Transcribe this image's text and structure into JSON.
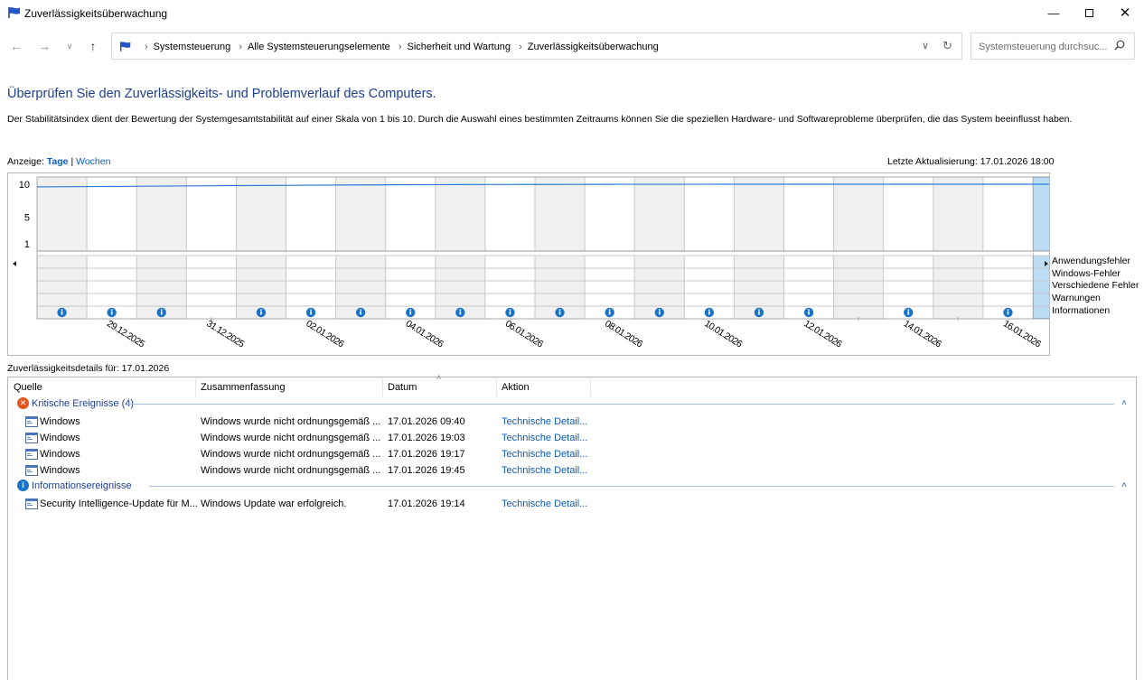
{
  "window": {
    "title": "Zuverlässigkeitsüberwachung"
  },
  "breadcrumbs": [
    "Systemsteuerung",
    "Alle Systemsteuerungselemente",
    "Sicherheit und Wartung",
    "Zuverlässigkeitsüberwachung"
  ],
  "search": {
    "placeholder": "Systemsteuerung durchsuc..."
  },
  "header": {
    "heading": "Überprüfen Sie den Zuverlässigkeits- und Problemverlauf des Computers.",
    "description": "Der Stabilitätsindex dient der Bewertung der Systemgesamtstabilität auf einer Skala von 1 bis 10. Durch die Auswahl eines bestimmten Zeitraums können Sie die speziellen Hardware- und Softwareprobleme überprüfen, die das System beeinflusst haben."
  },
  "view": {
    "label": "Anzeige:",
    "days": "Tage",
    "sep": "|",
    "weeks": "Wochen"
  },
  "last_update": "Letzte Aktualisierung: 17.01.2026 18:00",
  "chart_data": {
    "type": "line",
    "y_ticks": [
      "10",
      "5",
      "1"
    ],
    "ylim": [
      1,
      10
    ],
    "date_labels": [
      "29.12.2025",
      "31.12.2025",
      "02.01.2026",
      "04.01.2026",
      "06.01.2026",
      "08.01.2026",
      "10.01.2026",
      "12.01.2026",
      "14.01.2026",
      "16.01.2026"
    ],
    "days": [
      "28.12.2025",
      "29.12.2025",
      "30.12.2025",
      "31.12.2025",
      "01.01.2026",
      "02.01.2026",
      "03.01.2026",
      "04.01.2026",
      "05.01.2026",
      "06.01.2026",
      "07.01.2026",
      "08.01.2026",
      "09.01.2026",
      "10.01.2026",
      "11.01.2026",
      "12.01.2026",
      "13.01.2026",
      "14.01.2026",
      "15.01.2026",
      "16.01.2026",
      "17.01.2026"
    ],
    "stability_index": [
      9.6,
      9.65,
      9.7,
      9.75,
      9.8,
      9.84,
      9.88,
      9.91,
      9.94,
      9.96,
      9.97,
      9.98,
      9.99,
      9.99,
      10,
      10,
      10,
      10,
      10,
      10,
      9.0
    ],
    "info_events": [
      1,
      1,
      1,
      0,
      1,
      1,
      1,
      1,
      1,
      1,
      1,
      1,
      1,
      1,
      1,
      1,
      0,
      1,
      0,
      1,
      1
    ],
    "misc_error_events": [
      0,
      0,
      0,
      0,
      0,
      0,
      0,
      0,
      0,
      0,
      0,
      0,
      0,
      0,
      0,
      0,
      0,
      0,
      0,
      0,
      1
    ],
    "selected_day": "17.01.2026",
    "legend": [
      "Anwendungsfehler",
      "Windows-Fehler",
      "Verschiedene Fehler",
      "Warnungen",
      "Informationen"
    ]
  },
  "details": {
    "title": "Zuverlässigkeitsdetails für: 17.01.2026",
    "columns": [
      "Quelle",
      "Zusammenfassung",
      "Datum",
      "Aktion"
    ],
    "groups": [
      {
        "label": "Kritische Ereignisse (4)",
        "rows": [
          {
            "source": "Windows",
            "summary": "Windows wurde nicht ordnungsgemäß ...",
            "date": "17.01.2026 09:40",
            "action": "Technische Detail..."
          },
          {
            "source": "Windows",
            "summary": "Windows wurde nicht ordnungsgemäß ...",
            "date": "17.01.2026 19:03",
            "action": "Technische Detail..."
          },
          {
            "source": "Windows",
            "summary": "Windows wurde nicht ordnungsgemäß ...",
            "date": "17.01.2026 19:17",
            "action": "Technische Detail..."
          },
          {
            "source": "Windows",
            "summary": "Windows wurde nicht ordnungsgemäß ...",
            "date": "17.01.2026 19:45",
            "action": "Technische Detail..."
          }
        ]
      },
      {
        "label": "Informationsereignisse",
        "rows": [
          {
            "source": "Security Intelligence-Update für M...",
            "summary": "Windows Update war erfolgreich.",
            "date": "17.01.2026 19:14",
            "action": "Technische Detail..."
          }
        ]
      }
    ]
  },
  "colors": {
    "accent": "#0b5cb5",
    "heading": "#1e3e8e",
    "line": "#2b7bd6",
    "selection": "#bcdcf4",
    "error": "#e2551f",
    "info": "#1b73c9"
  },
  "icons": {
    "back": "arrow-left-icon",
    "forward": "arrow-right-icon",
    "up": "arrow-up-icon",
    "search": "search-icon",
    "refresh": "refresh-icon"
  }
}
